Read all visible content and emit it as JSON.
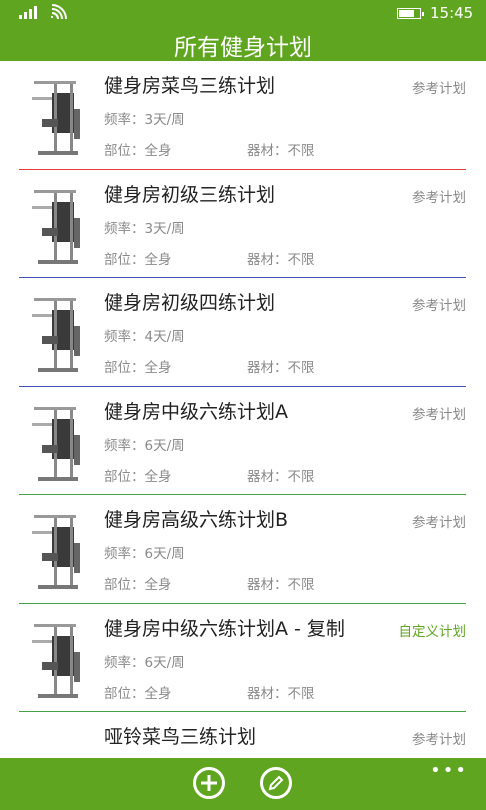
{
  "status": {
    "time": "15:45",
    "battery_level": 0.75
  },
  "header": {
    "title": "所有健身计划"
  },
  "plans": [
    {
      "name": "健身房菜鸟三练计划",
      "tag": "参考计划",
      "freq": "频率：3天/周",
      "part": "部位：全身",
      "equip": "器材：不限",
      "divider_color": "#e53935",
      "icon": "gym-machine-icon",
      "custom": false
    },
    {
      "name": "健身房初级三练计划",
      "tag": "参考计划",
      "freq": "频率：3天/周",
      "part": "部位：全身",
      "equip": "器材：不限",
      "divider_color": "#3f51b5",
      "icon": "gym-machine-icon",
      "custom": false
    },
    {
      "name": "健身房初级四练计划",
      "tag": "参考计划",
      "freq": "频率：4天/周",
      "part": "部位：全身",
      "equip": "器材：不限",
      "divider_color": "#3f51b5",
      "icon": "gym-machine-icon",
      "custom": false
    },
    {
      "name": "健身房中级六练计划A",
      "tag": "参考计划",
      "freq": "频率：6天/周",
      "part": "部位：全身",
      "equip": "器材：不限",
      "divider_color": "#43a047",
      "icon": "gym-machine-icon",
      "custom": false
    },
    {
      "name": "健身房高级六练计划B",
      "tag": "参考计划",
      "freq": "频率：6天/周",
      "part": "部位：全身",
      "equip": "器材：不限",
      "divider_color": "#43a047",
      "icon": "gym-machine-icon",
      "custom": false
    },
    {
      "name": "健身房中级六练计划A - 复制",
      "tag": "自定义计划",
      "freq": "频率：6天/周",
      "part": "部位：全身",
      "equip": "器材：不限",
      "divider_color": "#43a047",
      "icon": "gym-machine-icon",
      "custom": true
    },
    {
      "name": "哑铃菜鸟三练计划",
      "tag": "参考计划",
      "freq": "",
      "part": "",
      "equip": "",
      "divider_color": "",
      "icon": "dumbbell-icon",
      "custom": false
    }
  ],
  "app_bar": {
    "add_icon": "plus-icon",
    "edit_icon": "pencil-icon",
    "more_label": "•••"
  },
  "colors": {
    "accent": "#5fa520"
  }
}
